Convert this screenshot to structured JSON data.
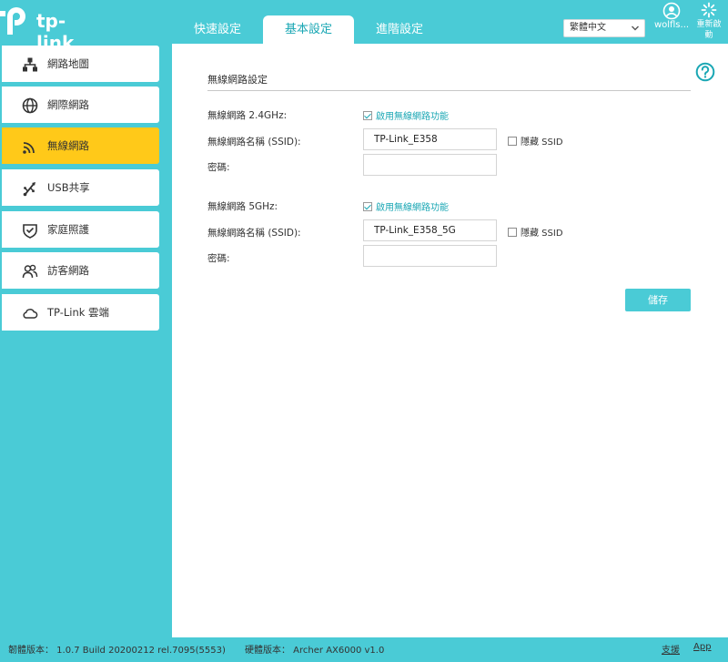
{
  "brand": {
    "logo_text": "tp-link"
  },
  "tabs": [
    {
      "label": "快速設定"
    },
    {
      "label": "基本設定"
    },
    {
      "label": "進階設定"
    }
  ],
  "header": {
    "language": "繁體中文",
    "user_label": "wolfls...",
    "reboot_label": "重新啟動"
  },
  "sidebar": {
    "items": [
      {
        "label": "網路地圖",
        "icon": "network-map-icon"
      },
      {
        "label": "網際網路",
        "icon": "globe-icon"
      },
      {
        "label": "無線網路",
        "icon": "wifi-icon",
        "active": true
      },
      {
        "label": "USB共享",
        "icon": "usb-icon"
      },
      {
        "label": "家庭照護",
        "icon": "shield-icon"
      },
      {
        "label": "訪客網路",
        "icon": "guest-users-icon"
      },
      {
        "label": "TP-Link 雲端",
        "icon": "cloud-icon"
      }
    ]
  },
  "main": {
    "section_title": "無線網路設定",
    "band24": {
      "label": "無線網路 2.4GHz:",
      "enable_label": "啟用無線網路功能",
      "enabled": true,
      "ssid_label": "無線網路名稱 (SSID):",
      "ssid_value": "TP-Link_E358",
      "hide_ssid_label": "隱藏 SSID",
      "hide_ssid": false,
      "password_label": "密碼:",
      "password_value": ""
    },
    "band5": {
      "label": "無線網路 5GHz:",
      "enable_label": "啟用無線網路功能",
      "enabled": true,
      "ssid_label": "無線網路名稱 (SSID):",
      "ssid_value": "TP-Link_E358_5G",
      "hide_ssid_label": "隱藏 SSID",
      "hide_ssid": false,
      "password_label": "密碼:",
      "password_value": ""
    },
    "save_label": "儲存"
  },
  "footer": {
    "firmware": "韌體版本： 1.0.7 Build 20200212 rel.7095(5553)",
    "hardware": "硬體版本： Archer AX6000 v1.0",
    "support_label": "支援",
    "app_label": "App"
  },
  "colors": {
    "accent": "#4acbd6",
    "active_tab_text": "#1aa7b4",
    "sidebar_active": "#ffc919"
  }
}
